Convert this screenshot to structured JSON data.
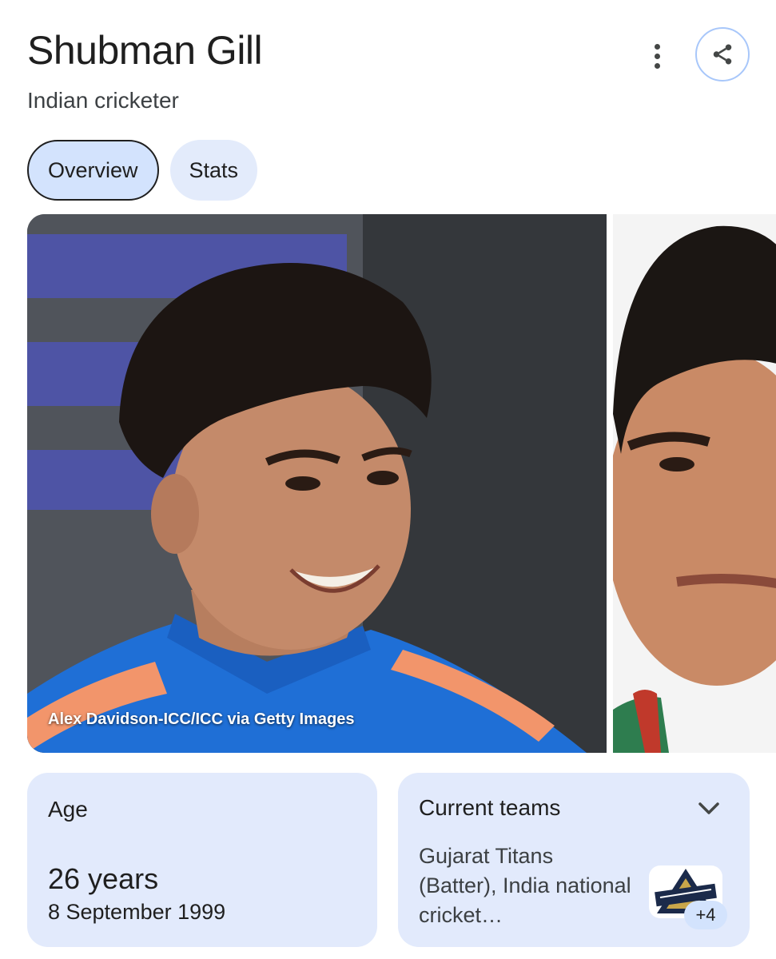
{
  "header": {
    "title": "Shubman Gill",
    "subtitle": "Indian cricketer"
  },
  "actions": {
    "more_icon": "more-vert-icon",
    "share_icon": "share-icon"
  },
  "tabs": [
    {
      "label": "Overview",
      "active": true
    },
    {
      "label": "Stats",
      "active": false
    }
  ],
  "gallery": {
    "photo_credit": "Alex Davidson-ICC/ICC via Getty Images"
  },
  "age_card": {
    "label": "Age",
    "value": "26 years",
    "date": "8 September 1999"
  },
  "teams_card": {
    "label": "Current teams",
    "text": "Gujarat Titans (Batter), India national cricket…",
    "logo_icon": "gujarat-titans-logo",
    "more_count": "+4"
  },
  "colors": {
    "accent_border": "#a8c7fa",
    "active_tab": "#d3e3fd",
    "card_bg": "#e2eafc",
    "jersey_blue": "#1f6fd6"
  }
}
